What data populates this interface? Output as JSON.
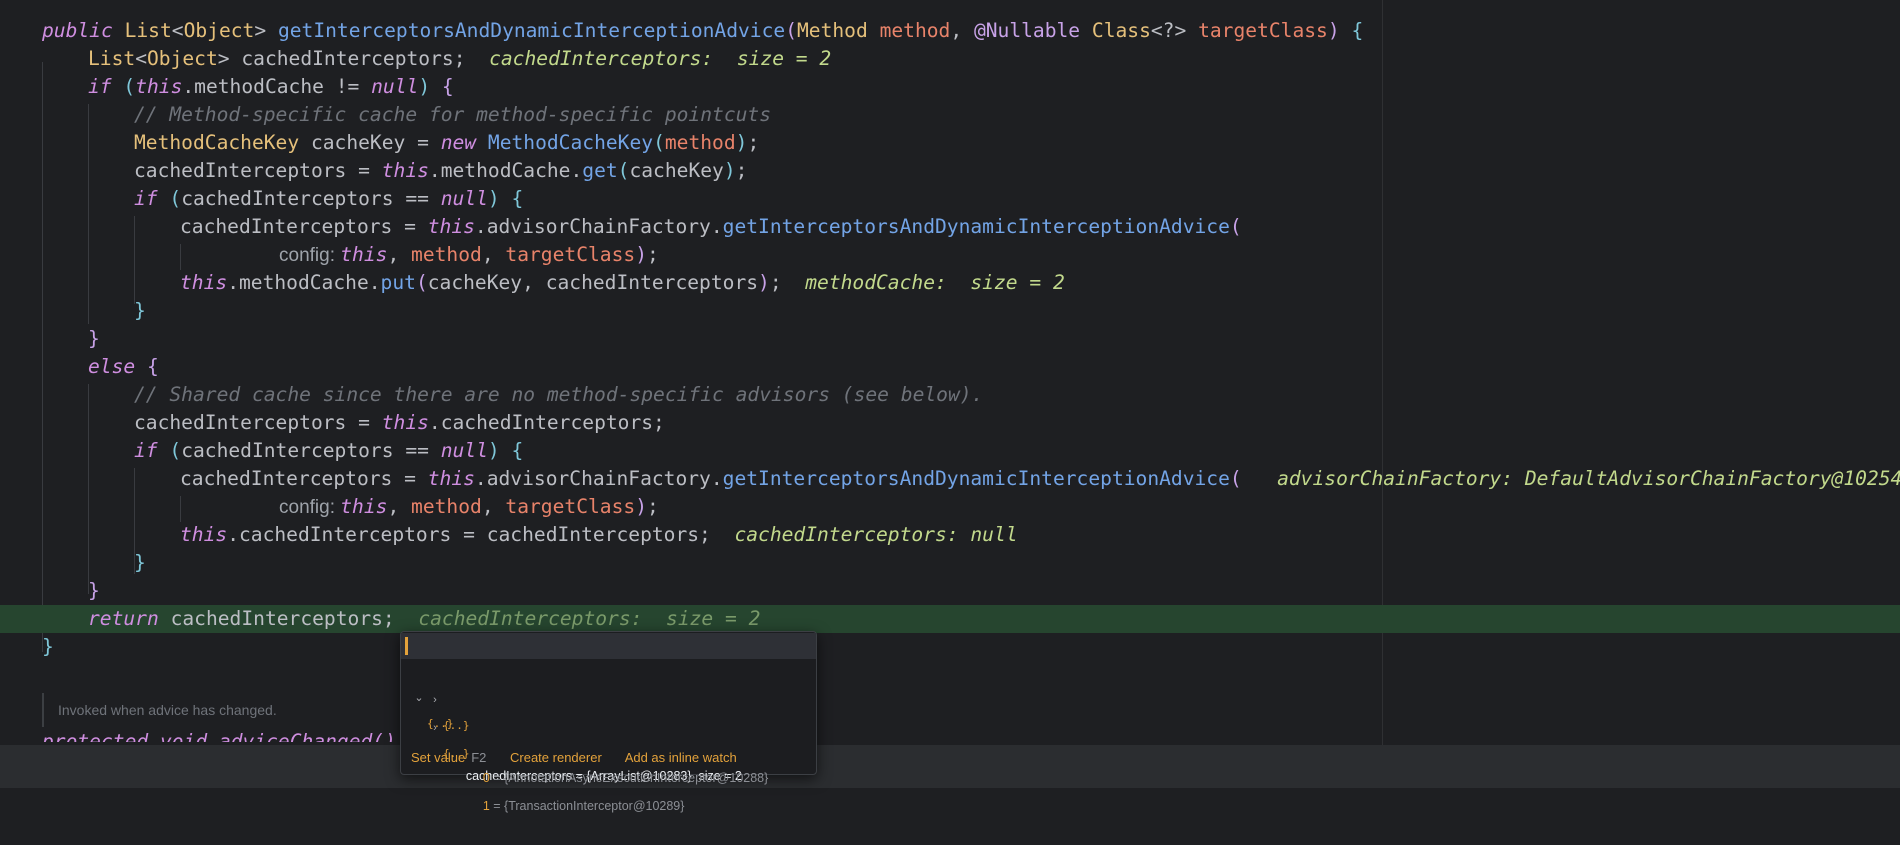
{
  "code": {
    "lines": [
      [
        [
          "kw",
          "public "
        ],
        [
          "type",
          "List"
        ],
        [
          "plain",
          "<"
        ],
        [
          "type",
          "Object"
        ],
        [
          "plain",
          "> "
        ],
        [
          "fn",
          "getInterceptorsAndDynamicInterceptionAdvice"
        ],
        [
          "br",
          "("
        ],
        [
          "type",
          "Method "
        ],
        [
          "param",
          "method"
        ],
        [
          "plain",
          ", "
        ],
        [
          "ann",
          "@Nullable "
        ],
        [
          "type",
          "Class"
        ],
        [
          "plain",
          "<?> "
        ],
        [
          "param",
          "targetClass"
        ],
        [
          "br",
          ")"
        ],
        [
          "plain",
          " "
        ],
        [
          "br2",
          "{"
        ]
      ],
      [
        [
          "type",
          "List"
        ],
        [
          "plain",
          "<"
        ],
        [
          "type",
          "Object"
        ],
        [
          "plain",
          "> cachedInterceptors;  "
        ],
        [
          "inl",
          "cachedInterceptors:  size = 2"
        ]
      ],
      [
        [
          "kw",
          "if "
        ],
        [
          "br2",
          "("
        ],
        [
          "kw",
          "this"
        ],
        [
          "plain",
          ".methodCache != "
        ],
        [
          "kw",
          "null"
        ],
        [
          "br2",
          ")"
        ],
        [
          "plain",
          " "
        ],
        [
          "br",
          "{"
        ]
      ],
      [
        [
          "cmt",
          "// Method-specific cache for method-specific pointcuts"
        ]
      ],
      [
        [
          "type",
          "MethodCacheKey "
        ],
        [
          "plain",
          "cacheKey = "
        ],
        [
          "kw",
          "new "
        ],
        [
          "fn",
          "MethodCacheKey"
        ],
        [
          "br2",
          "("
        ],
        [
          "param",
          "method"
        ],
        [
          "br2",
          ")"
        ],
        [
          "plain",
          ";"
        ]
      ],
      [
        [
          "plain",
          "cachedInterceptors = "
        ],
        [
          "kw",
          "this"
        ],
        [
          "plain",
          ".methodCache."
        ],
        [
          "fn",
          "get"
        ],
        [
          "br2",
          "("
        ],
        [
          "plain",
          "cacheKey"
        ],
        [
          "br2",
          ")"
        ],
        [
          "plain",
          ";"
        ]
      ],
      [
        [
          "kw",
          "if "
        ],
        [
          "br2",
          "("
        ],
        [
          "plain",
          "cachedInterceptors == "
        ],
        [
          "kw",
          "null"
        ],
        [
          "br2",
          ")"
        ],
        [
          "plain",
          " "
        ],
        [
          "br2",
          "{"
        ]
      ],
      [
        [
          "plain",
          "cachedInterceptors = "
        ],
        [
          "kw",
          "this"
        ],
        [
          "plain",
          ".advisorChainFactory."
        ],
        [
          "fn",
          "getInterceptorsAndDynamicInterceptionAdvice"
        ],
        [
          "br",
          "("
        ]
      ],
      [
        [
          "hint-label",
          "config: "
        ],
        [
          "kw",
          "this"
        ],
        [
          "plain",
          ", "
        ],
        [
          "param",
          "method"
        ],
        [
          "plain",
          ", "
        ],
        [
          "param",
          "targetClass"
        ],
        [
          "br",
          ")"
        ],
        [
          "plain",
          ";"
        ]
      ],
      [
        [
          "kw",
          "this"
        ],
        [
          "plain",
          ".methodCache."
        ],
        [
          "fn",
          "put"
        ],
        [
          "br",
          "("
        ],
        [
          "plain",
          "cacheKey, cachedInterceptors"
        ],
        [
          "br",
          ")"
        ],
        [
          "plain",
          ";  "
        ],
        [
          "inl",
          "methodCache:  size = 2"
        ]
      ],
      [
        [
          "br2",
          "}"
        ]
      ],
      [
        [
          "br",
          "}"
        ]
      ],
      [
        [
          "kw",
          "else "
        ],
        [
          "br",
          "{"
        ]
      ],
      [
        [
          "cmt",
          "// Shared cache since there are no method-specific advisors (see below)."
        ]
      ],
      [
        [
          "plain",
          "cachedInterceptors = "
        ],
        [
          "kw",
          "this"
        ],
        [
          "plain",
          ".cachedInterceptors;"
        ]
      ],
      [
        [
          "kw",
          "if "
        ],
        [
          "br2",
          "("
        ],
        [
          "plain",
          "cachedInterceptors == "
        ],
        [
          "kw",
          "null"
        ],
        [
          "br2",
          ")"
        ],
        [
          "plain",
          " "
        ],
        [
          "br2",
          "{"
        ]
      ],
      [
        [
          "plain",
          "cachedInterceptors = "
        ],
        [
          "kw",
          "this"
        ],
        [
          "plain",
          ".advisorChainFactory."
        ],
        [
          "fn",
          "getInterceptorsAndDynamicInterceptionAdvice"
        ],
        [
          "br",
          "("
        ],
        [
          "plain",
          "   "
        ],
        [
          "inl",
          "advisorChainFactory: DefaultAdvisorChainFactory@10254"
        ]
      ],
      [
        [
          "hint-label",
          "config: "
        ],
        [
          "kw",
          "this"
        ],
        [
          "plain",
          ", "
        ],
        [
          "param",
          "method"
        ],
        [
          "plain",
          ", "
        ],
        [
          "param",
          "targetClass"
        ],
        [
          "br",
          ")"
        ],
        [
          "plain",
          ";"
        ]
      ],
      [
        [
          "kw",
          "this"
        ],
        [
          "plain",
          ".cachedInterceptors = cachedInterceptors;  "
        ],
        [
          "inl",
          "cachedInterceptors: null"
        ]
      ],
      [
        [
          "br2",
          "}"
        ]
      ],
      [
        [
          "br",
          "}"
        ]
      ],
      [
        [
          "kw",
          "return "
        ],
        [
          "plain",
          "cachedInterceptors;  "
        ],
        [
          "inl-muted",
          "cachedInterceptors:  size = 2"
        ]
      ],
      [
        [
          "br2",
          "}"
        ]
      ]
    ],
    "doc_comment": "Invoked when advice has changed.",
    "cut_line": "protected void adviceChanged()"
  },
  "popup": {
    "root": {
      "name": "cachedInterceptors",
      "value": " = {ArrayList@10283}  size = 2"
    },
    "children": [
      {
        "index": "0",
        "value": " = {AnnotationAsyncExecutionInterceptor@10288}"
      },
      {
        "index": "1",
        "value": " = {TransactionInterceptor@10289}"
      }
    ],
    "footer": {
      "set_value": "Set value",
      "set_value_key": "F2",
      "create_renderer": "Create renderer",
      "add_inline_watch": "Add as inline watch"
    },
    "accent": "#e3a23b"
  },
  "colors": {
    "background": "#1e1f22",
    "execution_line": "#26452f"
  }
}
